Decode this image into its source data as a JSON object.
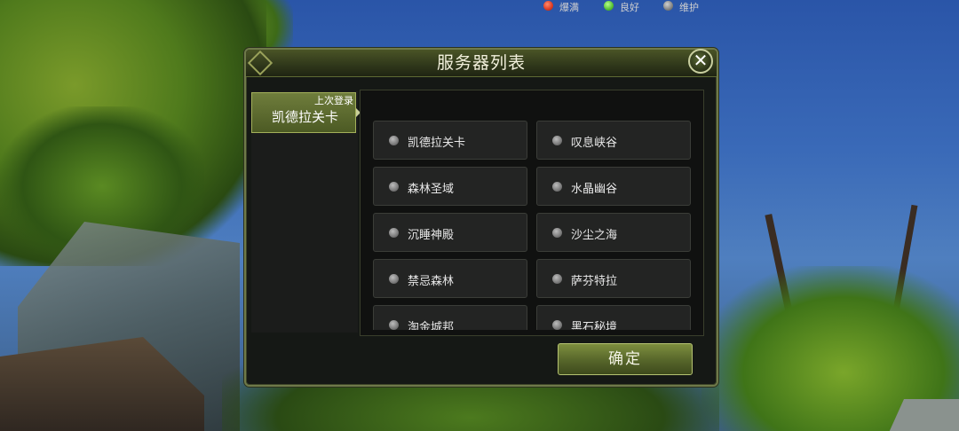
{
  "window": {
    "title": "服务器列表"
  },
  "sidebar": {
    "items": [
      {
        "tag": "上次登录",
        "label": "凯德拉关卡",
        "selected": true
      }
    ]
  },
  "legend": [
    {
      "label": "爆满",
      "color": "#e0402a",
      "icon": "status-dot-red"
    },
    {
      "label": "良好",
      "color": "#5cc63a",
      "icon": "status-dot-green"
    },
    {
      "label": "维护",
      "color": "#8a8a8a",
      "icon": "status-dot-gray"
    }
  ],
  "servers": [
    {
      "name": "凯德拉关卡",
      "status": "维护"
    },
    {
      "name": "叹息峡谷",
      "status": "维护"
    },
    {
      "name": "森林圣域",
      "status": "维护"
    },
    {
      "name": "水晶幽谷",
      "status": "维护"
    },
    {
      "name": "沉睡神殿",
      "status": "维护"
    },
    {
      "name": "沙尘之海",
      "status": "维护"
    },
    {
      "name": "禁忌森林",
      "status": "维护"
    },
    {
      "name": "萨芬特拉",
      "status": "维护"
    },
    {
      "name": "淘金城邦",
      "status": "维护"
    },
    {
      "name": "黑石秘境",
      "status": "维护"
    }
  ],
  "actions": {
    "confirm_label": "确定",
    "close_icon": "close-icon"
  }
}
